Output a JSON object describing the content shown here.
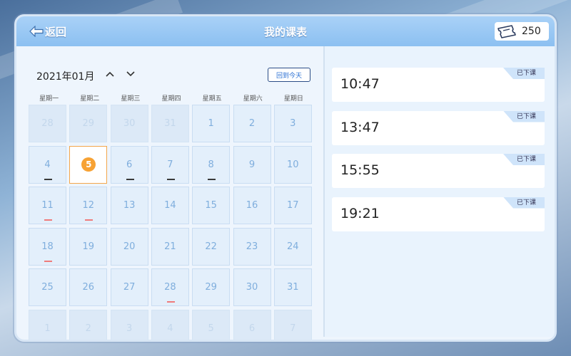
{
  "header": {
    "back_label": "返回",
    "title": "我的课表",
    "coin_count": "250"
  },
  "calendar": {
    "month_label": "2021年01月",
    "today_label": "回到今天",
    "weekdays": [
      "星期一",
      "星期二",
      "星期三",
      "星期四",
      "星期五",
      "星期六",
      "星期日"
    ],
    "days": [
      {
        "n": "28",
        "other": true
      },
      {
        "n": "29",
        "other": true
      },
      {
        "n": "30",
        "other": true
      },
      {
        "n": "31",
        "other": true
      },
      {
        "n": "1"
      },
      {
        "n": "2"
      },
      {
        "n": "3"
      },
      {
        "n": "4",
        "mark": "dark"
      },
      {
        "n": "5",
        "selected": true
      },
      {
        "n": "6",
        "mark": "dark"
      },
      {
        "n": "7",
        "mark": "dark"
      },
      {
        "n": "8",
        "mark": "dark"
      },
      {
        "n": "9"
      },
      {
        "n": "10"
      },
      {
        "n": "11",
        "mark": "red"
      },
      {
        "n": "12",
        "mark": "red"
      },
      {
        "n": "13"
      },
      {
        "n": "14"
      },
      {
        "n": "15"
      },
      {
        "n": "16"
      },
      {
        "n": "17"
      },
      {
        "n": "18",
        "mark": "red"
      },
      {
        "n": "19"
      },
      {
        "n": "20"
      },
      {
        "n": "21"
      },
      {
        "n": "22"
      },
      {
        "n": "23"
      },
      {
        "n": "24"
      },
      {
        "n": "25"
      },
      {
        "n": "26"
      },
      {
        "n": "27"
      },
      {
        "n": "28",
        "mark": "red"
      },
      {
        "n": "29"
      },
      {
        "n": "30"
      },
      {
        "n": "31"
      },
      {
        "n": "1",
        "other": true
      },
      {
        "n": "2",
        "other": true
      },
      {
        "n": "3",
        "other": true
      },
      {
        "n": "4",
        "other": true
      },
      {
        "n": "5",
        "other": true
      },
      {
        "n": "6",
        "other": true
      },
      {
        "n": "7",
        "other": true
      }
    ]
  },
  "classes": [
    {
      "time": "10:47",
      "status": "已下课"
    },
    {
      "time": "13:47",
      "status": "已下课"
    },
    {
      "time": "15:55",
      "status": "已下课"
    },
    {
      "time": "19:21",
      "status": "已下课"
    }
  ],
  "colors": {
    "mark_dark": "#3a3a3a",
    "mark_red": "#ef7b7b",
    "selected_badge": "#f7a234",
    "header": "#94c6f3"
  },
  "icons": {
    "back": "arrow-left-icon",
    "coin": "ticket-icon",
    "prev": "chevron-up-icon",
    "next": "chevron-down-icon"
  }
}
